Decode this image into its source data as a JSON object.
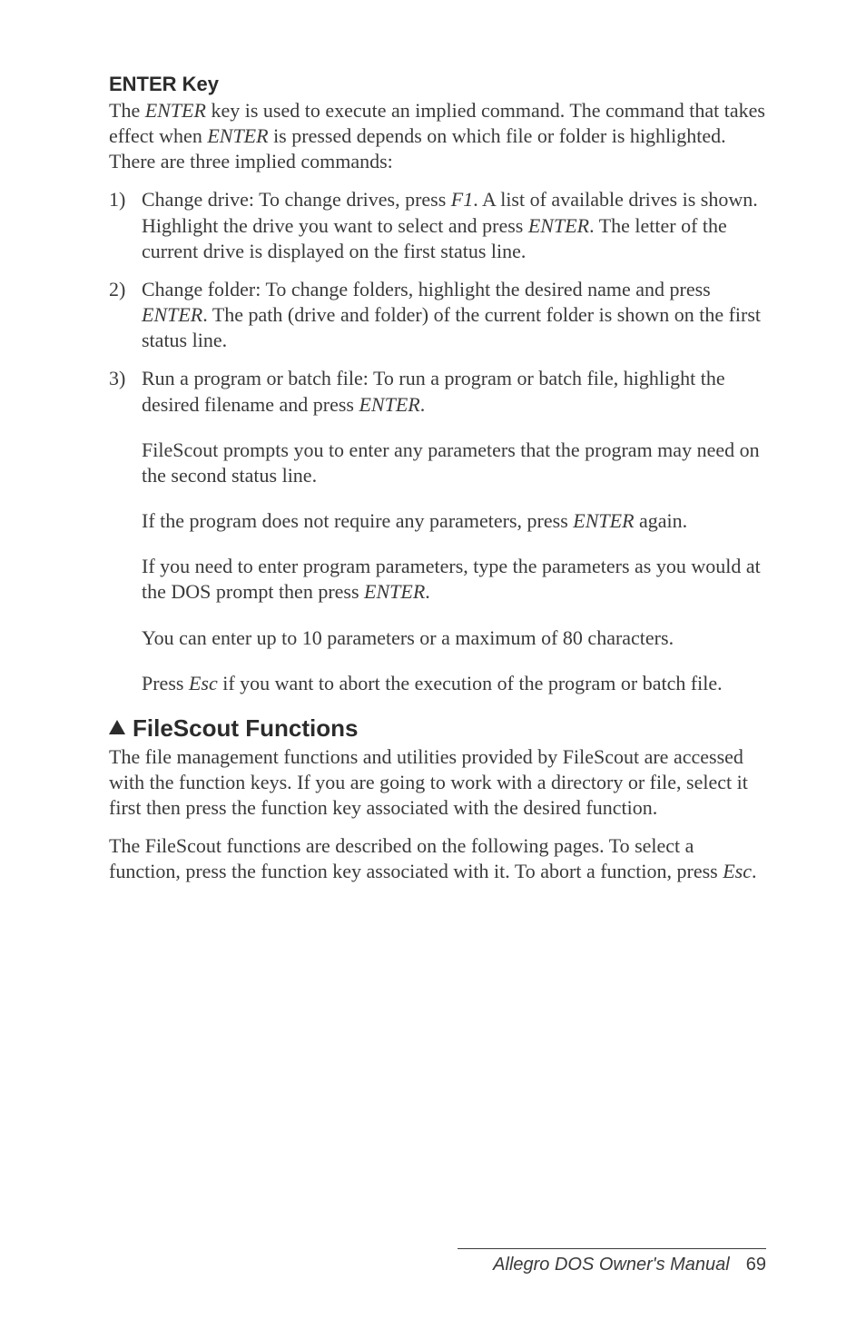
{
  "section1": {
    "heading": "ENTER Key",
    "intro_parts": {
      "p1": "The ",
      "k1": "ENTER",
      "p2": " key is used to execute an implied command. The command that takes effect when ",
      "k2": "ENTER",
      "p3": " is pressed depends on which file or folder is highlighted. There are three implied commands:"
    },
    "items": [
      {
        "p1": "Change drive:  To change drives, press ",
        "k1": "F1",
        "p2": ". A list of available drives is shown. Highlight the drive you want to select and press ",
        "k2": "ENTER",
        "p3": ". The letter of the current drive is displayed on the first status line."
      },
      {
        "p1": "Change folder:  To change folders, highlight the desired name and press ",
        "k1": "ENTER",
        "p2": ". The path (drive and folder) of the current folder is shown on the first status line."
      },
      {
        "p1": "Run a program or batch file:  To run a program or batch file, highlight the desired filename and press ",
        "k1": "ENTER",
        "p2": "."
      }
    ],
    "subs": [
      {
        "text": "FileScout prompts you to enter any parameters that the program may need on the second status line."
      },
      {
        "p1": "If the program does not require any parameters, press ",
        "k1": "ENTER",
        "p2": " again."
      },
      {
        "p1": "If you need to enter program parameters, type the parameters as you would at the DOS prompt then press ",
        "k1": "ENTER",
        "p2": "."
      },
      {
        "text": "You can enter up to 10 parameters or a maximum of 80 characters."
      },
      {
        "p1": "Press ",
        "k1": "Esc",
        "p2": " if you want to abort the execution of the program or batch file."
      }
    ]
  },
  "section2": {
    "heading": "FileScout Functions",
    "para1": "The file management functions and utilities provided by FileScout are accessed with the function keys. If you are going to work with a directory or file, select it first then press the function key associated with the desired function.",
    "para2": {
      "p1": "The FileScout functions are described on the following pages. To select a function, press the function key associated with it. To abort a function, press ",
      "k1": "Esc",
      "p2": "."
    }
  },
  "footer": {
    "title": "Allegro DOS Owner's Manual",
    "page": "69"
  }
}
